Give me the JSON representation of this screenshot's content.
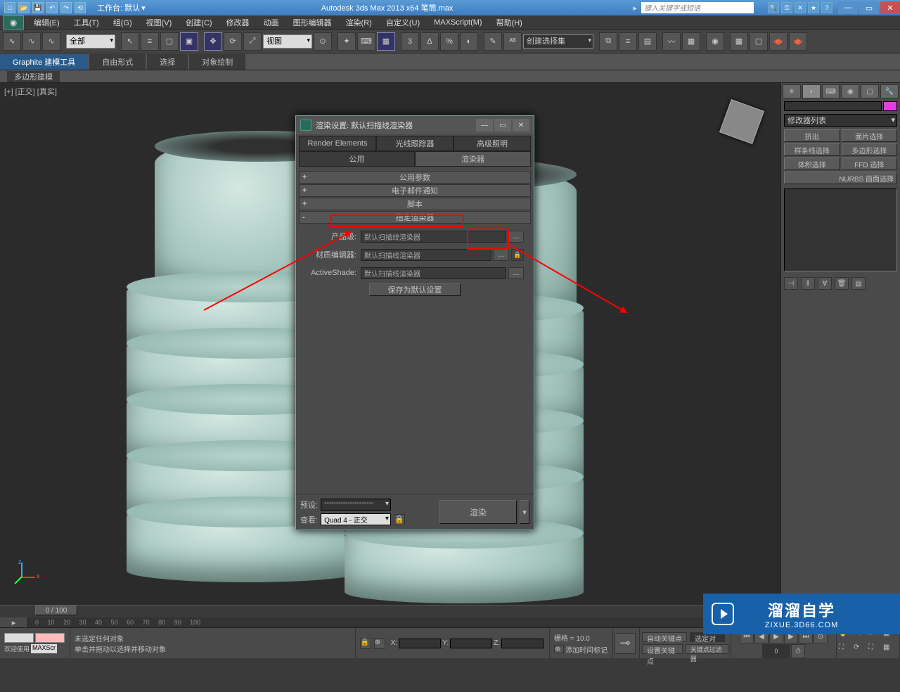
{
  "titlebar": {
    "workspace_label": "工作台: 默认",
    "app_title": "Autodesk 3ds Max  2013 x64     笔筒.max",
    "search_placeholder": "键入关键字或短语"
  },
  "menus": [
    "编辑(E)",
    "工具(T)",
    "组(G)",
    "视图(V)",
    "创建(C)",
    "修改器",
    "动画",
    "图形编辑器",
    "渲染(R)",
    "自定义(U)",
    "MAXScript(M)",
    "帮助(H)"
  ],
  "maintoolbar": {
    "selfilter": "全部",
    "viewmode": "视图",
    "namedset": "创建选择集"
  },
  "ribbon_tabs": [
    "Graphite 建模工具",
    "自由形式",
    "选择",
    "对象绘制"
  ],
  "subribbon": "多边形建模",
  "viewport_label": "[+] [正交] [真实]",
  "cmdpanel": {
    "modlist": "修改器列表",
    "buttons": [
      "挤出",
      "面片选择",
      "样条线选择",
      "多边形选择",
      "体积选择",
      "FFD 选择"
    ],
    "nurbs": "NURBS 曲面选择"
  },
  "dialog": {
    "title": "渲染设置: 默认扫描线渲染器",
    "tabs_top": [
      "Render Elements",
      "光线跟踪器",
      "高级照明"
    ],
    "tabs_bottom": [
      "公用",
      "渲染器"
    ],
    "rollouts": {
      "r1": "公用参数",
      "r2": "电子邮件通知",
      "r3": "脚本",
      "r4": "指定渲染器"
    },
    "rows": {
      "prod_label": "产品级:",
      "prod_value": "默认扫描线渲染器",
      "mat_label": "材质编辑器:",
      "mat_value": "默认扫描线渲染器",
      "as_label": "ActiveShade:",
      "as_value": "默认扫描线渲染器"
    },
    "save_default": "保存为默认设置",
    "preset_label": "预设:",
    "preset_value": "---------------------",
    "view_label": "查看:",
    "view_value": "Quad 4 - 正交",
    "render_btn": "渲染"
  },
  "timeline": {
    "pos": "0 / 100"
  },
  "status": {
    "none_selected": "未选定任何对象",
    "hint": "单击并拖动以选择并移动对象",
    "grid": "栅格 = 10.0",
    "autokey": "自动关键点",
    "selset": "选定对",
    "setkey": "设置关键点",
    "keyfilter": "关键点过滤器",
    "addtime": "添加时间标记",
    "welcome": "欢迎使用",
    "maxscr": "MAXScr"
  },
  "watermark": {
    "brand": "溜溜自学",
    "url": "ZIXUE.3D66.COM"
  }
}
